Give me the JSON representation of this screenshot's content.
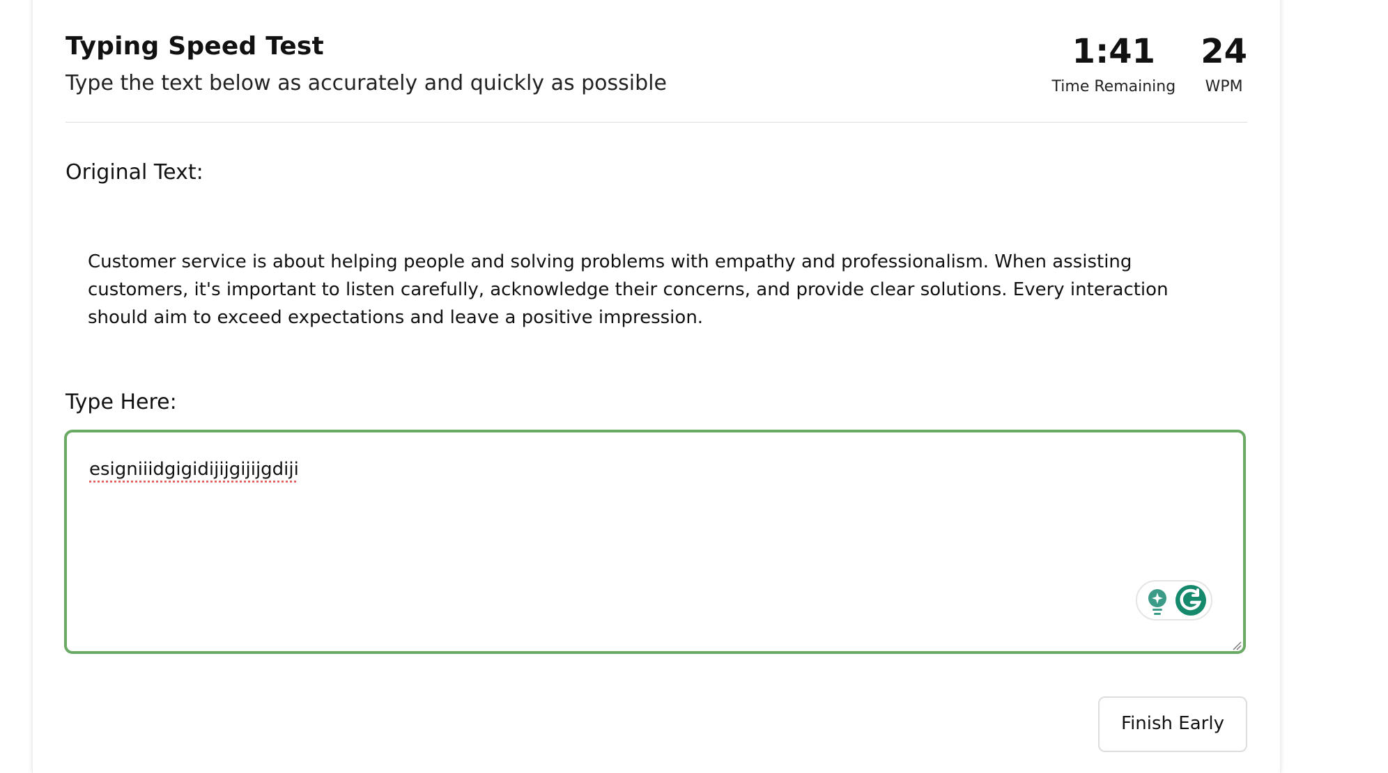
{
  "header": {
    "title": "Typing Speed Test",
    "subtitle": "Type the text below as accurately and quickly as possible"
  },
  "stats": {
    "time_value": "1:41",
    "time_label": "Time Remaining",
    "wpm_value": "24",
    "wpm_label": "WPM"
  },
  "original": {
    "label": "Original Text:",
    "text": "Customer service is about helping people and solving problems with empathy and professionalism. When assisting customers, it's important to listen carefully, acknowledge their concerns, and provide clear solutions. Every interaction should aim to exceed expectations and leave a positive impression."
  },
  "input": {
    "label": "Type Here:",
    "value": "esigniiidgigidijijgijijgdiji"
  },
  "grammarly": {
    "icons": [
      "lightbulb-icon",
      "grammarly-g-icon"
    ],
    "accent_color": "#3b9b86",
    "brand_color": "#15896b"
  },
  "actions": {
    "finish_label": "Finish Early"
  },
  "colors": {
    "input_border": "#6aaa64",
    "divider": "#dddddd",
    "spellcheck_underline": "#e05050"
  }
}
